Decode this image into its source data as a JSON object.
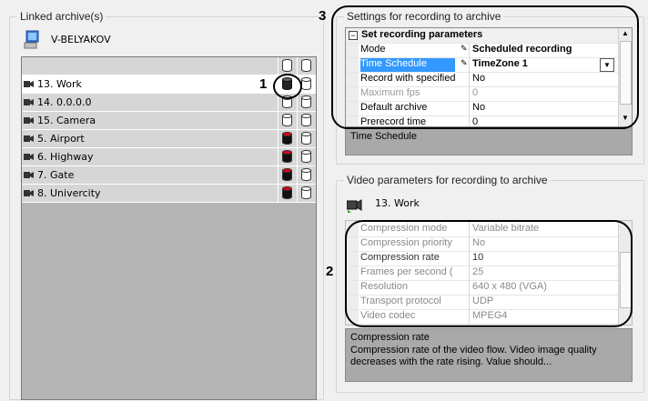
{
  "linked_archives": {
    "title": "Linked archive(s)",
    "server_name": "V-BELYAKOV",
    "rows": [
      {
        "label": "13. Work",
        "archive1": "linked-callout",
        "archive2": "empty"
      },
      {
        "label": "14. 0.0.0.0",
        "archive1": "empty",
        "archive2": "empty"
      },
      {
        "label": "15. Camera",
        "archive1": "empty",
        "archive2": "empty"
      },
      {
        "label": "5. Airport",
        "archive1": "recording",
        "archive2": "empty"
      },
      {
        "label": "6. Highway",
        "archive1": "recording",
        "archive2": "empty"
      },
      {
        "label": "7. Gate",
        "archive1": "recording",
        "archive2": "empty"
      },
      {
        "label": "8. Univercity",
        "archive1": "recording",
        "archive2": "empty"
      }
    ]
  },
  "recording_settings": {
    "title": "Settings for recording to archive",
    "category": "Set recording parameters",
    "properties": [
      {
        "name": "Mode",
        "value": "Scheduled recording",
        "bold": true
      },
      {
        "name": "Time Schedule",
        "value": "TimeZone 1",
        "bold": true,
        "selected": true
      },
      {
        "name": "Record with specified",
        "value": "No"
      },
      {
        "name": "Maximum fps",
        "value": "0",
        "disabled": true
      },
      {
        "name": "Default archive",
        "value": "No"
      },
      {
        "name": "Prerecord time",
        "value": "0"
      }
    ],
    "description_title": "Time Schedule",
    "description_text": ""
  },
  "video_settings": {
    "title": "Video parameters for recording to archive",
    "camera_label": "13. Work",
    "properties": [
      {
        "name": "Compression mode",
        "value": "Variable bitrate"
      },
      {
        "name": "Compression priority",
        "value": "No"
      },
      {
        "name": "Compression rate",
        "value": "10",
        "active": true
      },
      {
        "name": "Frames per second (",
        "value": "25"
      },
      {
        "name": "Resolution",
        "value": "640 x 480 (VGA)"
      },
      {
        "name": "Transport protocol",
        "value": "UDP"
      },
      {
        "name": "Video codec",
        "value": "MPEG4"
      }
    ],
    "description_title": "Compression rate",
    "description_text": "Compression rate of the video flow. Video image quality decreases with the rate rising.  Value should..."
  },
  "callouts": {
    "one": "1",
    "two": "2",
    "three": "3"
  },
  "colors": {
    "selection": "#3399ff",
    "desc_bg": "#a9a9a9",
    "grid_bg": "#b5b5b5",
    "record_red": "#e0001a"
  }
}
